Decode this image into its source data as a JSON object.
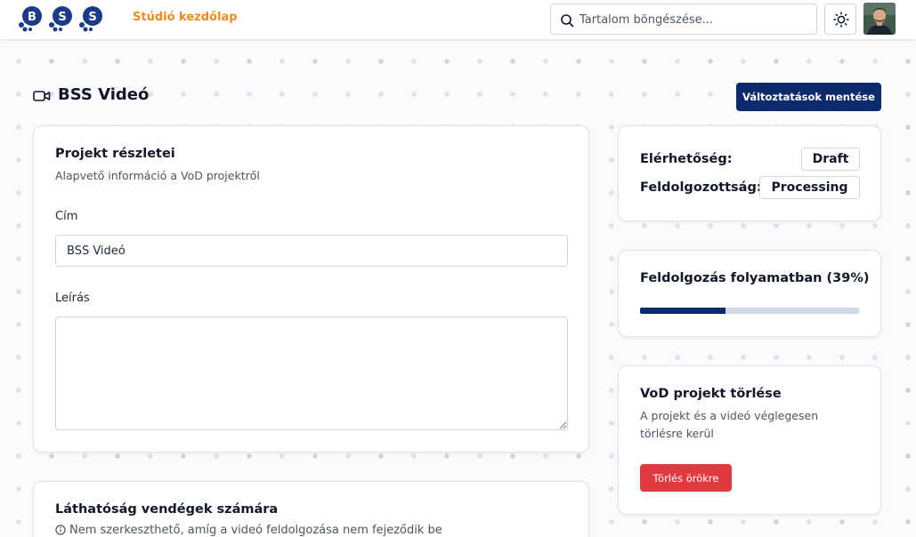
{
  "header": {
    "logo_letters": [
      "B",
      "S",
      "S"
    ],
    "studio_link": "Stúdió kezdőlap",
    "search_placeholder": "Tartalom böngészése...",
    "theme_icon": "sun-icon",
    "avatar_icon": "user-avatar"
  },
  "page": {
    "title": "BSS Videó",
    "title_icon": "video-camera-icon",
    "save_label": "Változtatások mentése"
  },
  "details": {
    "title": "Projekt részletei",
    "subtitle": "Alapvető információ a VoD projektről",
    "title_label": "Cím",
    "title_value": "BSS Videó",
    "description_label": "Leírás",
    "description_value": ""
  },
  "visibility": {
    "title": "Láthatóság vendégek számára",
    "note": "Nem szerkeszthető, amíg a videó feldolgozása nem fejeződik be",
    "note_icon": "info-circle-icon"
  },
  "status": {
    "availability_label": "Elérhetőség:",
    "availability_value": "Draft",
    "processing_label": "Feldolgozottság:",
    "processing_value": "Processing"
  },
  "progress": {
    "label": "Feldolgozás folyamatban (39%)",
    "percent": 39
  },
  "delete": {
    "title": "VoD projekt törlése",
    "description": "A projekt és a videó véglegesen törlésre kerül",
    "button_label": "Törlés örökre"
  },
  "colors": {
    "brand_navy": "#0d2a6e",
    "accent_orange": "#f08a1e",
    "danger_red": "#e03a40"
  }
}
